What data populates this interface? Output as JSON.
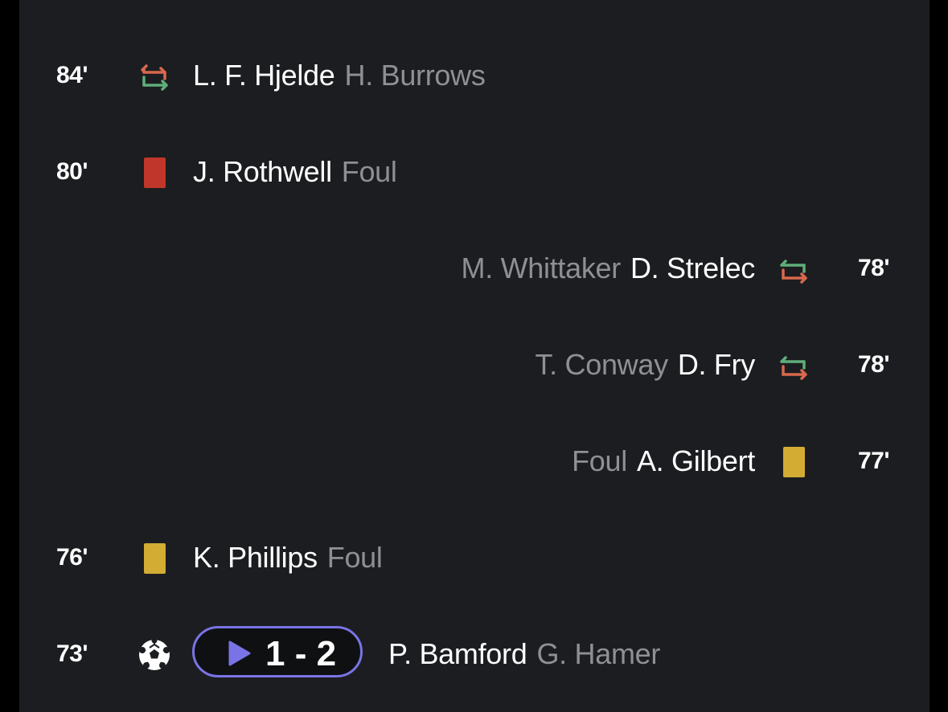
{
  "events": [
    {
      "minute": "84'",
      "side": "home",
      "type": "substitution",
      "player_in": "L. F. Hjelde",
      "player_out": "H. Burrows",
      "icon": "substitution-icon"
    },
    {
      "minute": "80'",
      "side": "home",
      "type": "red-card",
      "player": "J. Rothwell",
      "reason": "Foul",
      "icon": "red-card-icon"
    },
    {
      "minute": "78'",
      "side": "away",
      "type": "substitution",
      "player_out": "M. Whittaker",
      "player_in": "D. Strelec",
      "icon": "substitution-icon"
    },
    {
      "minute": "78'",
      "side": "away",
      "type": "substitution",
      "player_out": "T. Conway",
      "player_in": "D. Fry",
      "icon": "substitution-icon"
    },
    {
      "minute": "77'",
      "side": "away",
      "type": "yellow-card",
      "reason": "Foul",
      "player": "A. Gilbert",
      "icon": "yellow-card-icon"
    },
    {
      "minute": "76'",
      "side": "home",
      "type": "yellow-card",
      "player": "K. Phillips",
      "reason": "Foul",
      "icon": "yellow-card-icon"
    },
    {
      "minute": "73'",
      "side": "home",
      "type": "goal",
      "score": "1 - 2",
      "scorer": "P. Bamford",
      "assist": "G. Hamer",
      "icon": "football-icon",
      "play_icon": "play-icon"
    }
  ],
  "colors": {
    "background": "#1b1d20",
    "primary_text": "#ffffff",
    "secondary_text": "#8e9094",
    "sub_in": "#5fae7a",
    "sub_out": "#d8684e",
    "red_card": "#c0362a",
    "yellow_card": "#d2ac33",
    "highlight_accent": "#7a73e6"
  }
}
